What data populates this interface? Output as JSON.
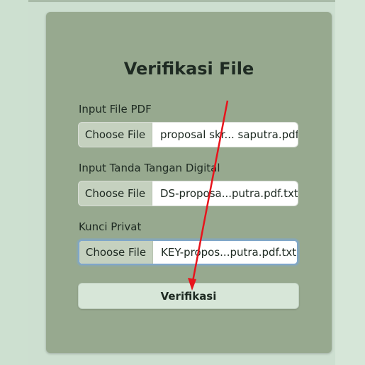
{
  "form": {
    "title": "Verifikasi File",
    "fields": [
      {
        "label": "Input File PDF",
        "button_label": "Choose File",
        "file_name": "proposal skr... saputra.pdf"
      },
      {
        "label": "Input Tanda Tangan Digital",
        "button_label": "Choose File",
        "file_name": "DS-proposa...putra.pdf.txt"
      },
      {
        "label": "Kunci Privat",
        "button_label": "Choose File",
        "file_name": "KEY-propos...putra.pdf.txt"
      }
    ],
    "submit_label": "Verifikasi"
  },
  "annotation": {
    "arrow_color": "#e8141c"
  }
}
